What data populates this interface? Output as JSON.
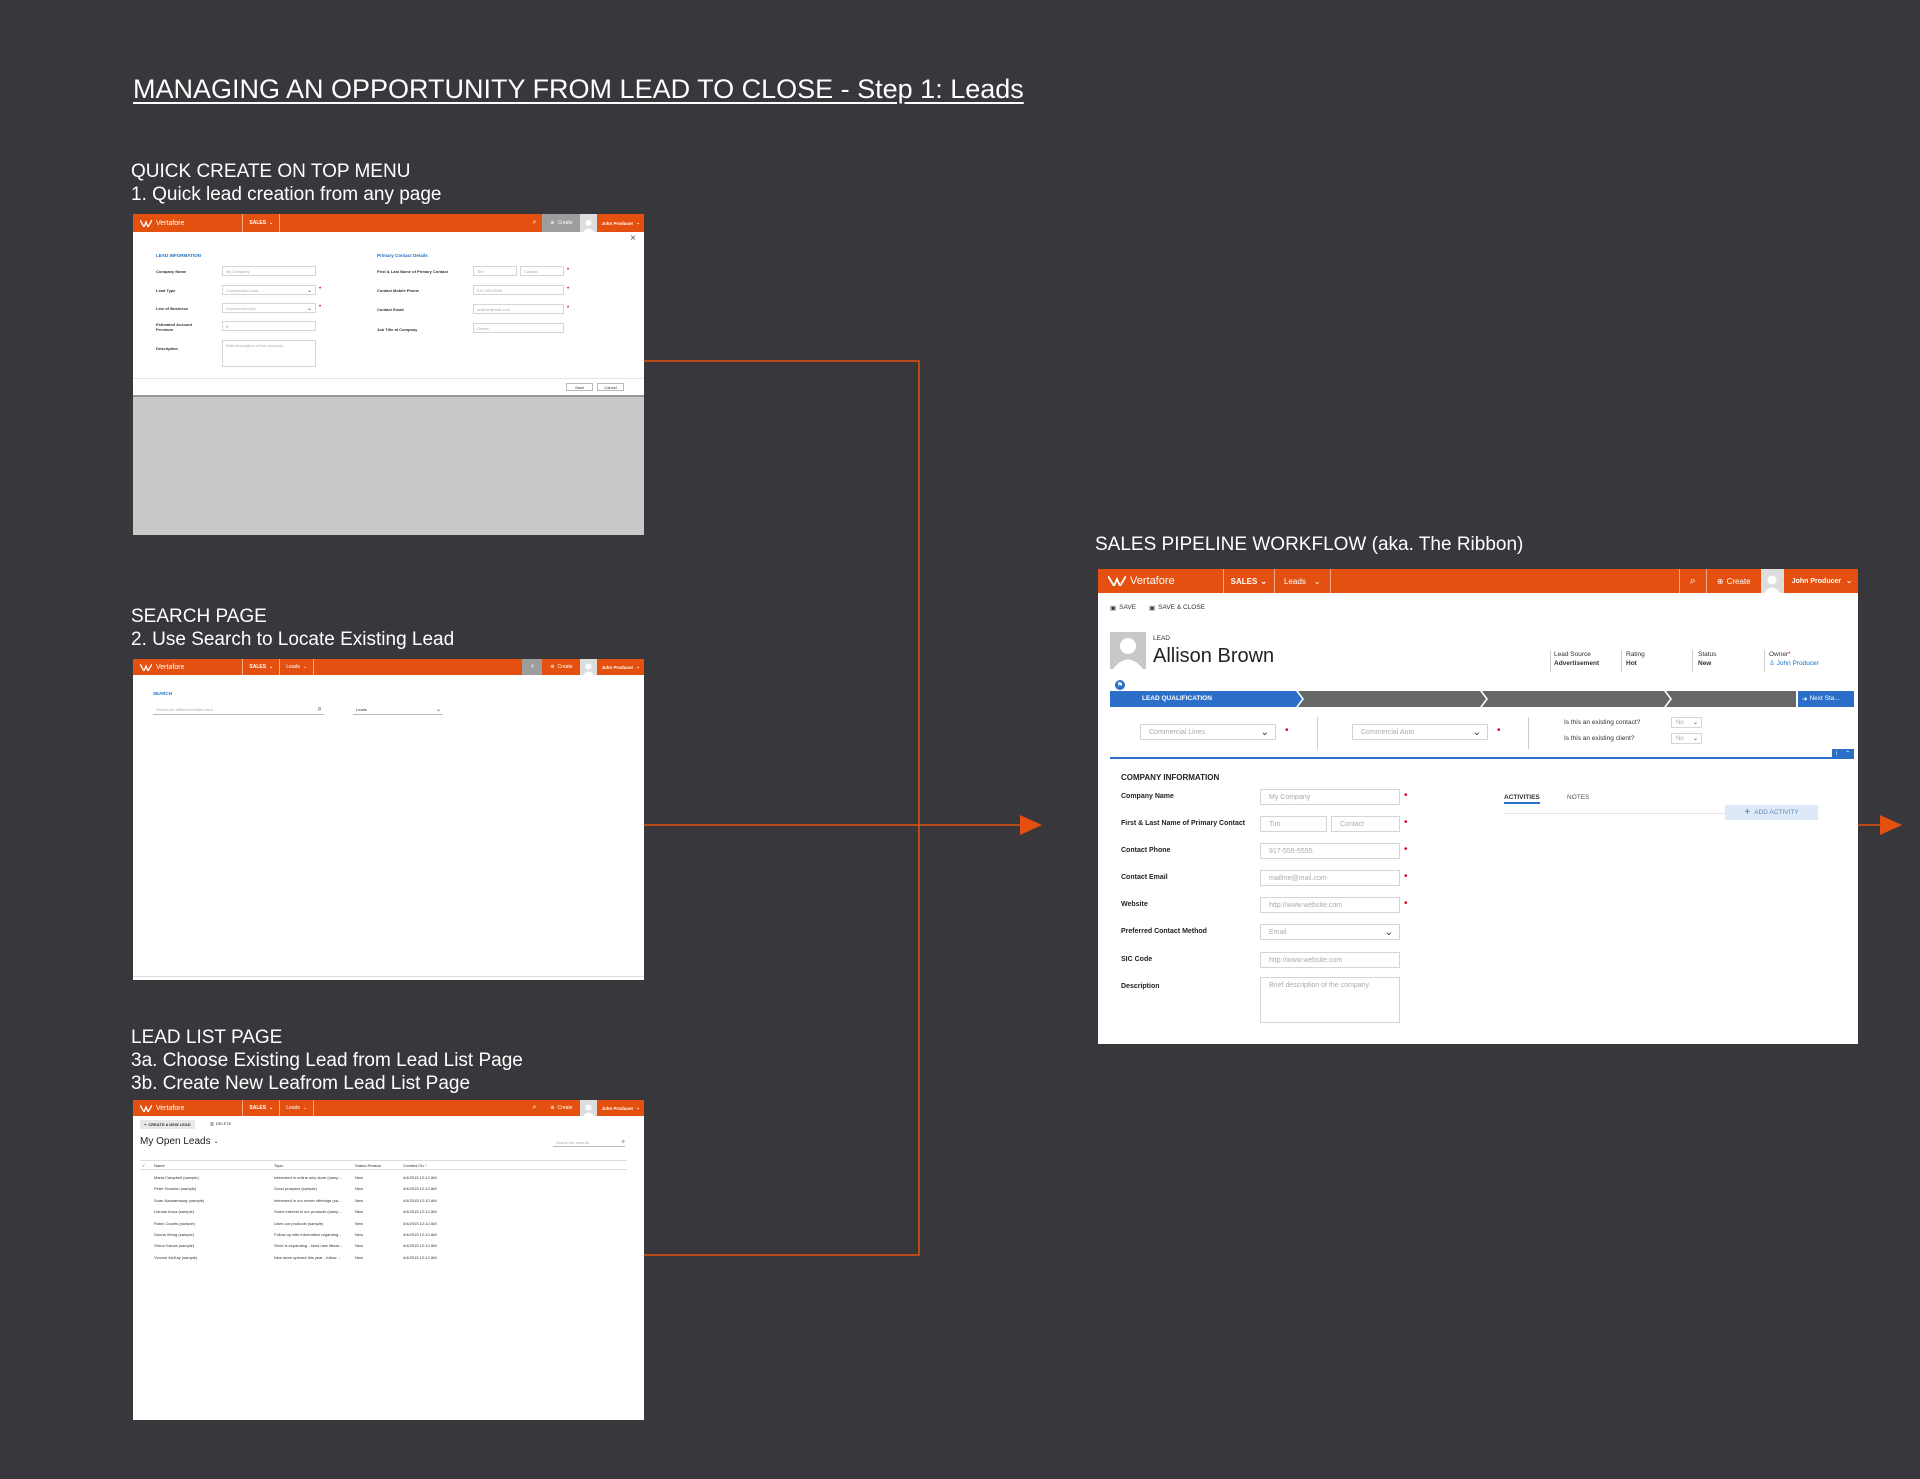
{
  "title": "MANAGING AN OPPORTUNITY FROM LEAD TO CLOSE - Step 1: Leads",
  "sections": {
    "quick_create": {
      "heading": "QUICK CREATE ON TOP MENU",
      "lines": [
        "1. Quick lead creation from any page"
      ]
    },
    "search": {
      "heading": "SEARCH PAGE",
      "lines": [
        "2. Use Search to Locate Existing Lead"
      ]
    },
    "lead_list": {
      "heading": "LEAD LIST PAGE",
      "lines": [
        "3a. Choose Existing Lead from Lead List Page",
        "3b. Create New Leafrom Lead List Page"
      ]
    },
    "pipeline": {
      "heading": "SALES PIPELINE WORKFLOW (aka. The Ribbon)"
    }
  },
  "colors": {
    "background": "#37373c",
    "brand": "#e4500f",
    "connector": "#e4500f",
    "ribbon_active": "#2b6fc9",
    "ribbon_step": "#666666"
  },
  "app": {
    "brand": "Vertafore",
    "nav_sales": "SALES",
    "nav_leads": "Leads",
    "create": "Create",
    "user": "John Producer"
  },
  "quick_create_form": {
    "lead_info_heading": "LEAD INFORMATION",
    "contact_heading": "Primary Contact Details",
    "close_icon": "×",
    "fields": [
      {
        "label": "Company Name",
        "value": "My Company"
      },
      {
        "label": "Lead Type",
        "value": "Commercial Lines"
      },
      {
        "label": "Line of Business",
        "value": "Commercial Auto"
      },
      {
        "label": "Estimated Account Premium",
        "value": "$"
      },
      {
        "label": "Description",
        "value": "Brief description of the company"
      }
    ],
    "contact_fields": [
      {
        "label": "First & Last Name of Primary Contact",
        "value": "Tim",
        "value2": "Contact"
      },
      {
        "label": "Contact Mobile Phone",
        "value": "917-555-5555"
      },
      {
        "label": "Contact Email",
        "value": "mailme@mail.com"
      },
      {
        "label": "Job Title at Company",
        "value": "Owner"
      }
    ],
    "save": "Save",
    "cancel": "Cancel"
  },
  "search_page": {
    "heading": "SEARCH",
    "placeholder": "Search for different entities here",
    "filter": "Leads"
  },
  "lead_list_page": {
    "create_new": "CREATE A NEW LEAD",
    "delete": "DELETE",
    "view_title": "My Open Leads",
    "search_placeholder": "Search for records",
    "columns": [
      "Name",
      "Topic",
      "Status Reason",
      "Created On"
    ],
    "rows": [
      [
        "Maria Campbell (sample)",
        "Interested in online only store (samp...",
        "New",
        "4/4/2015 12:12 AM"
      ],
      [
        "Peter Houston (sample)",
        "Good prospect (sample)",
        "New",
        "4/4/2015 12:12 AM"
      ],
      [
        "Suan Nanaamiway (sample)",
        "Interested in our newer offerings (sa...",
        "New",
        "4/4/2015 12:12 AM"
      ],
      [
        "Lidman Anna (sample)",
        "Some interest in our products (samp...",
        "New",
        "4/4/2015 12:12 AM"
      ],
      [
        "Robin Counts (sample)",
        "Likes our products (sample)",
        "New",
        "4/4/2015 12:12 AM"
      ],
      [
        "Dourla Wong (sample)",
        "Follow up with information regarding...",
        "New",
        "4/4/2015 12:12 AM"
      ],
      [
        "Onina Garcia (sample)",
        "Store is expanding - send new literat...",
        "New",
        "4/4/2015 12:12 AM"
      ],
      [
        "Yvonne McKay (sample)",
        "New store opened this year - follow ...",
        "New",
        "4/4/2015 12:12 AM"
      ]
    ]
  },
  "lead_record": {
    "save": "SAVE",
    "save_close": "SAVE & CLOSE",
    "entity": "LEAD",
    "name": "Allison Brown",
    "meta": [
      {
        "label": "Lead Source",
        "value": "Advertisement"
      },
      {
        "label": "Rating",
        "value": "Hot"
      },
      {
        "label": "Status",
        "value": "New"
      },
      {
        "label": "Owner",
        "value": "John Producer"
      }
    ],
    "ribbon_stage": "LEAD QUALIFICATION",
    "next_stage": "Next Sta...",
    "stage_fields": {
      "lead_type": "Commercial Lines",
      "lob": "Commercial Auto"
    },
    "questions": [
      {
        "label": "Is this an existing contact?",
        "value": "No"
      },
      {
        "label": "Is this an existing client?",
        "value": "No"
      }
    ],
    "company_heading": "COMPANY INFORMATION",
    "fields": [
      {
        "label": "Company Name",
        "value": "My Company"
      },
      {
        "label": "First & Last Name of Primary Contact",
        "value": "Tim",
        "value2": "Contact"
      },
      {
        "label": "Contact Phone",
        "value": "917-555-5555"
      },
      {
        "label": "Contact Email",
        "value": "mailme@mail.com"
      },
      {
        "label": "Website",
        "value": "http://www.website.com"
      },
      {
        "label": "Preferred Contact Method",
        "value": "Email"
      },
      {
        "label": "SIC Code",
        "value": "http://www.website.com"
      },
      {
        "label": "Description",
        "value": "Brief description of the company"
      }
    ],
    "tabs": [
      "ACTIVITIES",
      "NOTES"
    ],
    "add_activity": "ADD ACTIVITY"
  }
}
